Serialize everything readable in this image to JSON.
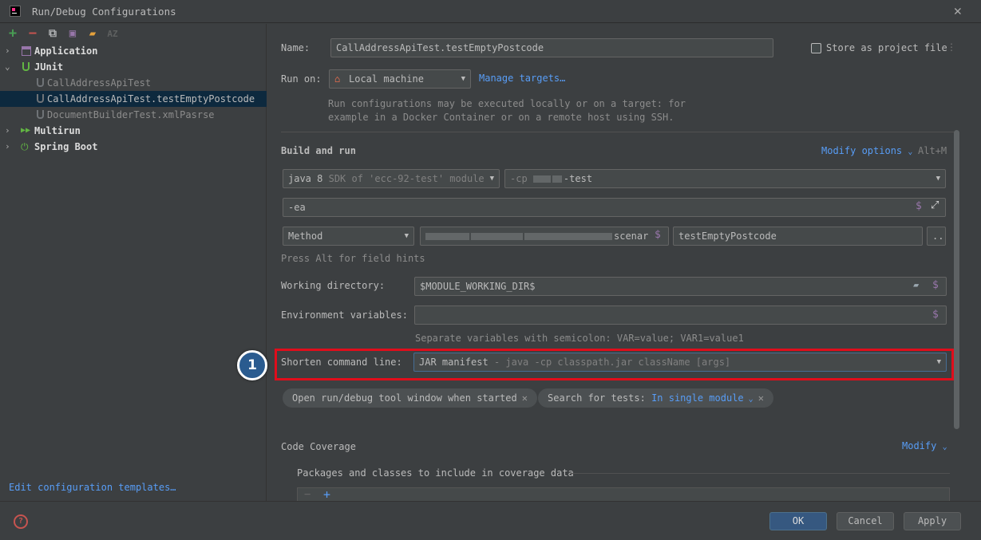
{
  "window": {
    "title": "Run/Debug Configurations"
  },
  "tree": {
    "application": "Application",
    "junit": "JUnit",
    "call_api": "CallAddressApiTest",
    "call_api_method": "CallAddressApiTest.testEmptyPostcode",
    "doc_builder": "DocumentBuilderTest.xmlPasrse",
    "multirun": "Multirun",
    "spring_boot": "Spring Boot"
  },
  "edit_templates": "Edit configuration templates…",
  "form": {
    "name_label": "Name:",
    "name_value": "CallAddressApiTest.testEmptyPostcode",
    "store_label": "Store as project file",
    "run_on_label": "Run on:",
    "run_on_value": "Local machine",
    "manage_targets": "Manage targets…",
    "run_note_1": "Run configurations may be executed locally or on a target: for",
    "run_note_2": "example in a Docker Container or on a remote host using SSH.",
    "build_run": "Build and run",
    "modify_options": "Modify options",
    "modify_shortcut": "Alt+M",
    "jdk_main": "java 8",
    "jdk_hint": "SDK of 'ecc-92-test' module",
    "cp_prefix": "-cp",
    "cp_suffix": "-test",
    "vm_options": "-ea",
    "test_kind": "Method",
    "class_tail": "scenar",
    "method_value": "testEmptyPostcode",
    "more_button": "...",
    "alt_hint": "Press Alt for field hints",
    "workdir_label": "Working directory:",
    "workdir_value": "$MODULE_WORKING_DIR$",
    "env_label": "Environment variables:",
    "env_note": "Separate variables with semicolon: VAR=value; VAR1=value1",
    "shorten_label": "Shorten command line:",
    "shorten_value": "JAR manifest",
    "shorten_hint": "- java -cp classpath.jar className [args]",
    "chip_open_tool": "Open run/debug tool window when started",
    "chip_search_label": "Search for tests:",
    "chip_search_value": "In single module",
    "code_coverage": "Code Coverage",
    "modify": "Modify",
    "packages_label": "Packages and classes to include in coverage data"
  },
  "badge": "1",
  "buttons": {
    "ok": "OK",
    "cancel": "Cancel",
    "apply": "Apply"
  },
  "colors": {
    "accent_link": "#589df6",
    "highlight_border": "#e00d1b",
    "badge_bg": "#2a5b8f"
  }
}
